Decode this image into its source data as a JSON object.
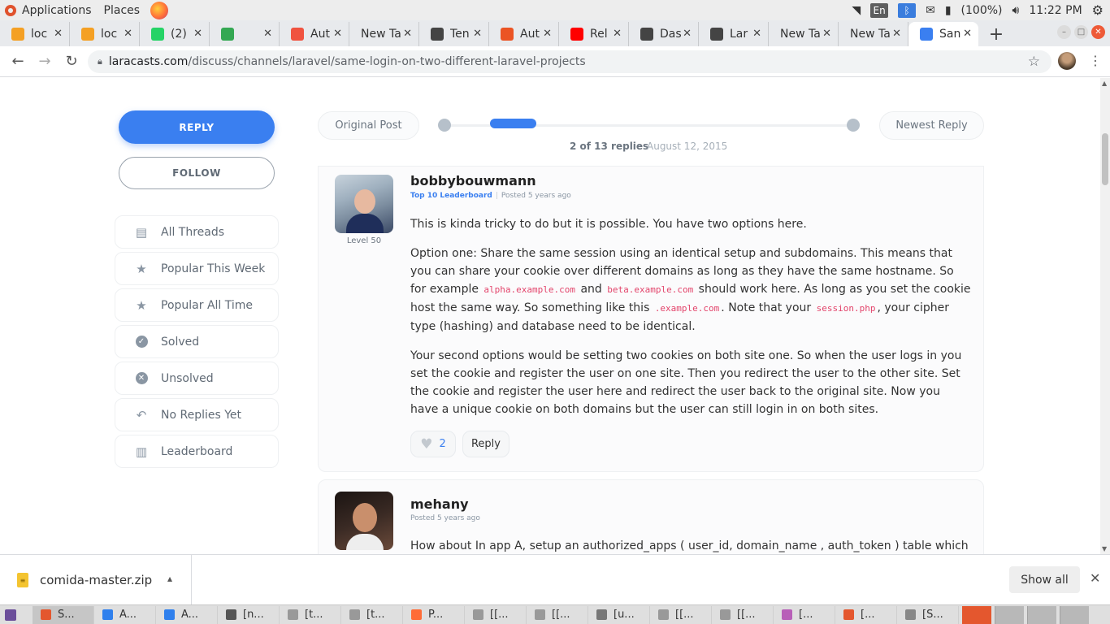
{
  "topbar": {
    "applications": "Applications",
    "places": "Places",
    "lang": "En",
    "battery": "(100%)",
    "clock": "11:22 PM"
  },
  "tabs": [
    {
      "label": "loc",
      "icon": "phpmyadmin-icon",
      "color": "#f4a024"
    },
    {
      "label": "loc",
      "icon": "phpmyadmin-icon",
      "color": "#f4a024"
    },
    {
      "label": "(2)",
      "icon": "whatsapp-icon",
      "color": "#25d366"
    },
    {
      "label": "",
      "icon": "meet-icon",
      "color": "#34a853"
    },
    {
      "label": "Aut",
      "icon": "laravel-icon",
      "color": "#f05340"
    },
    {
      "label": "New Ta",
      "icon": "",
      "color": ""
    },
    {
      "label": "Ten",
      "icon": "globe-icon",
      "color": "#444"
    },
    {
      "label": "Aut",
      "icon": "auth0-icon",
      "color": "#eb5424"
    },
    {
      "label": "Rel",
      "icon": "youtube-icon",
      "color": "#ff0000"
    },
    {
      "label": "Das",
      "icon": "globe-icon",
      "color": "#444"
    },
    {
      "label": "Lar",
      "icon": "globe-icon",
      "color": "#444"
    },
    {
      "label": "New Ta",
      "icon": "",
      "color": ""
    },
    {
      "label": "New Ta",
      "icon": "",
      "color": ""
    },
    {
      "label": "San",
      "icon": "laracasts-icon",
      "color": "#3a7ff0"
    }
  ],
  "address": {
    "host": "laracasts.com",
    "path": "/discuss/channels/laravel/same-login-on-two-different-laravel-projects"
  },
  "sidebar": {
    "reply": "REPLY",
    "follow": "FOLLOW",
    "items": [
      {
        "label": "All Threads",
        "icon": "threads-icon"
      },
      {
        "label": "Popular This Week",
        "icon": "star-icon"
      },
      {
        "label": "Popular All Time",
        "icon": "star-icon"
      },
      {
        "label": "Solved",
        "icon": "check-circle-icon"
      },
      {
        "label": "Unsolved",
        "icon": "x-circle-icon"
      },
      {
        "label": "No Replies Yet",
        "icon": "reply-arrow-icon"
      },
      {
        "label": "Leaderboard",
        "icon": "clipboard-icon"
      }
    ]
  },
  "timeline": {
    "original_post": "Original Post",
    "newest_reply": "Newest Reply",
    "position": "2 of 13 replies",
    "date": "August 12, 2015"
  },
  "replies": [
    {
      "username": "bobbybouwmann",
      "badge": "Top 10 Leaderboard",
      "posted": "Posted 5 years ago",
      "level": "Level 50",
      "p1": "This is kinda tricky to do but it is possible. You have two options here.",
      "p2_a": "Option one: Share the same session using an identical setup and subdomains. This means that you can share your cookie over different domains as long as they have the same hostname. So for example ",
      "code1": "alpha.example.com",
      "p2_b": " and ",
      "code2": "beta.example.com",
      "p2_c": " should work here. As long as you set the cookie host the same way. So something like this ",
      "code3": ".example.com",
      "p2_d": ". Note that your ",
      "code4": "session.php",
      "p2_e": ", your cipher type (hashing) and database need to be identical.",
      "p3": "Your second options would be setting two cookies on both site one. So when the user logs in you set the cookie and register the user on one site. Then you redirect the user to the other site. Set the cookie and register the user here and redirect the user back to the original site. Now you have a unique cookie on both domains but the user can still login in on both sites.",
      "likes": "2",
      "reply": "Reply"
    },
    {
      "username": "mehany",
      "posted": "Posted 5 years ago",
      "p1": "How about In app A, setup an authorized_apps ( user_id, domain_name , auth_token ) table which is the"
    }
  ],
  "downloads": {
    "file": "comida-master.zip",
    "show_all": "Show all"
  },
  "taskbar": [
    {
      "label": "S...",
      "color": "#e4572e"
    },
    {
      "label": "A...",
      "color": "#2f80ed"
    },
    {
      "label": "A...",
      "color": "#2f80ed"
    },
    {
      "label": "[n...",
      "color": "#555"
    },
    {
      "label": "[t...",
      "color": "#999"
    },
    {
      "label": "[t...",
      "color": "#999"
    },
    {
      "label": "P...",
      "color": "#ff6c37"
    },
    {
      "label": "[[...",
      "color": "#999"
    },
    {
      "label": "[[...",
      "color": "#999"
    },
    {
      "label": "[u...",
      "color": "#777"
    },
    {
      "label": "[[...",
      "color": "#999"
    },
    {
      "label": "[[...",
      "color": "#999"
    },
    {
      "label": "[...",
      "color": "#b85fb8"
    },
    {
      "label": "[...",
      "color": "#e4572e"
    },
    {
      "label": "[S...",
      "color": "#888"
    }
  ]
}
